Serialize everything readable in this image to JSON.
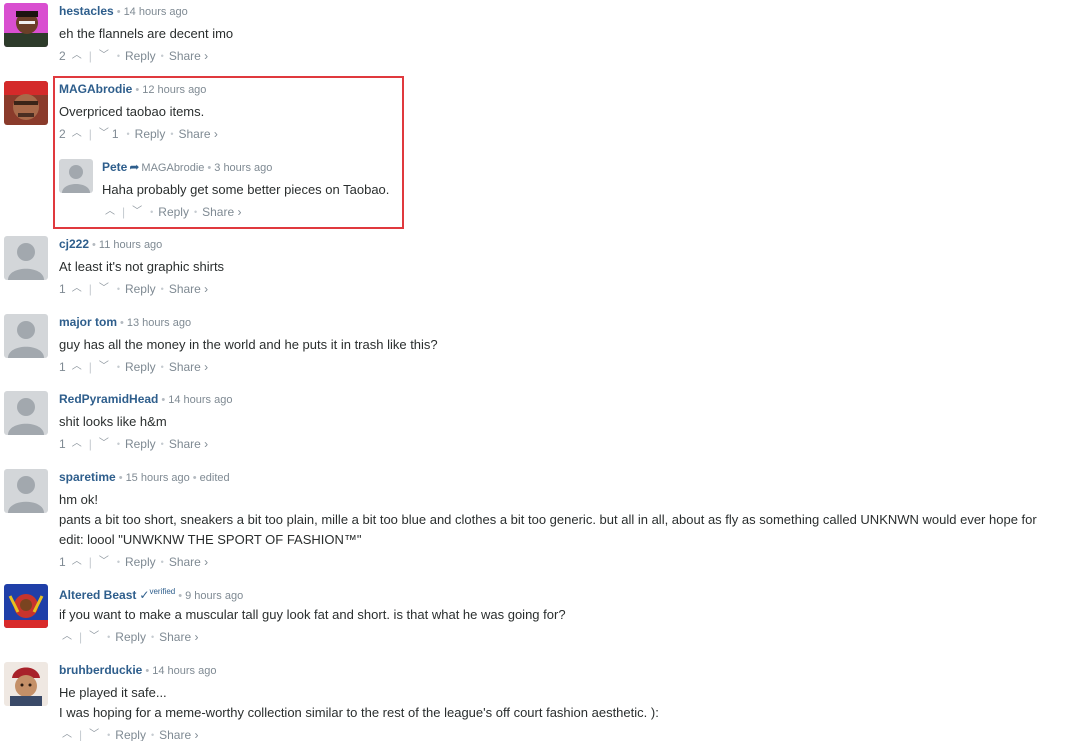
{
  "colors": {
    "author": "#2e5e8c",
    "meta": "#7f8a93",
    "highlight": "#e0393e"
  },
  "comments": [
    {
      "author": "hestacles",
      "time": "14 hours ago",
      "lines": [
        "eh the flannels are decent imo"
      ],
      "up": "2",
      "down": "",
      "reply": "Reply",
      "share": "Share ›"
    },
    {
      "author": "MAGAbrodie",
      "time": "12 hours ago",
      "lines": [
        "Overpriced taobao items."
      ],
      "up": "2",
      "down": "1",
      "reply": "Reply",
      "share": "Share ›"
    },
    {
      "author": "cj222",
      "time": "11 hours ago",
      "lines": [
        "At least it's not graphic shirts"
      ],
      "up": "1",
      "down": "",
      "reply": "Reply",
      "share": "Share ›"
    },
    {
      "author": "major tom",
      "time": "13 hours ago",
      "lines": [
        "guy has all the money in the world and he puts it in trash like this?"
      ],
      "up": "1",
      "down": "",
      "reply": "Reply",
      "share": "Share ›"
    },
    {
      "author": "RedPyramidHead",
      "time": "14 hours ago",
      "lines": [
        "shit looks like h&m"
      ],
      "up": "1",
      "down": "",
      "reply": "Reply",
      "share": "Share ›"
    },
    {
      "author": "sparetime",
      "time": "15 hours ago",
      "edited": "edited",
      "lines": [
        "hm ok!",
        "pants a bit too short, sneakers a bit too plain, mille a bit too blue and clothes a bit too generic. but all in all, about as fly as something called UNKNWN would ever hope for",
        "edit: loool \"UNWKNW THE SPORT OF FASHION™\""
      ],
      "up": "1",
      "down": "",
      "reply": "Reply",
      "share": "Share ›"
    },
    {
      "author": "Altered Beast",
      "verified": "verified",
      "time": "9 hours ago",
      "lines": [
        "if you want to make a muscular tall guy look fat and short. is that what he was going for?"
      ],
      "up": "",
      "down": "",
      "reply": "Reply",
      "share": "Share ›"
    },
    {
      "author": "bruhberduckie",
      "time": "14 hours ago",
      "lines": [
        "He played it safe...",
        "I was hoping for a meme-worthy collection similar to the rest of the league's off court fashion aesthetic. ):"
      ],
      "up": "",
      "down": "",
      "reply": "Reply",
      "share": "Share ›"
    }
  ],
  "reply": {
    "author": "Pete",
    "parent": "MAGAbrodie",
    "time": "3 hours ago",
    "lines": [
      "Haha probably get some better pieces on Taobao."
    ],
    "up": "",
    "down": "",
    "reply": "Reply",
    "share": "Share ›"
  },
  "icons": {
    "upvote": "chevron-up-icon",
    "downvote": "chevron-down-icon",
    "reply_to": "arrow-right-icon",
    "verified": "checkmark-icon"
  }
}
